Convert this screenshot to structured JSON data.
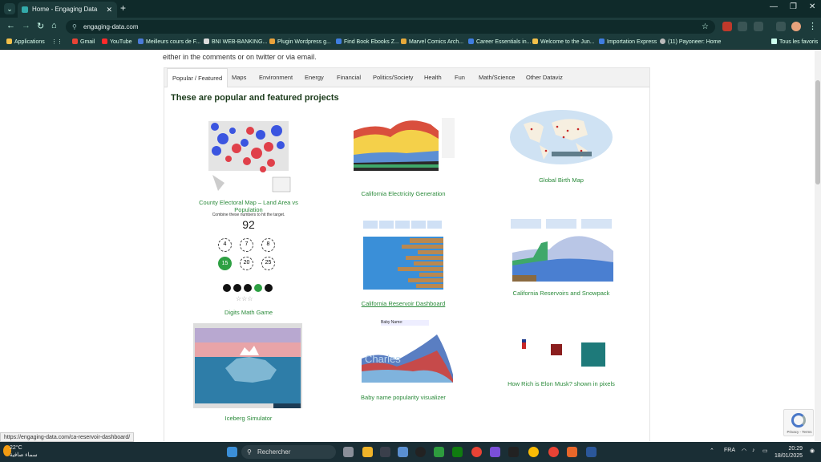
{
  "browser": {
    "tab_title": "Home - Engaging Data",
    "new_tab": "+",
    "url": "engaging-data.com",
    "bookmarks": [
      {
        "label": "Applications",
        "color": "#f3c04a"
      },
      {
        "label": "Gmail",
        "color": "#e94335"
      },
      {
        "label": "YouTube",
        "color": "#ff2a2a"
      },
      {
        "label": "Meilleurs cours de F...",
        "color": "#4b7bd8"
      },
      {
        "label": "BNI WEB-BANKING...",
        "color": "#dddddd"
      },
      {
        "label": "Plugin Wordpress g...",
        "color": "#e9a23b"
      },
      {
        "label": "Find Book Ebooks Z...",
        "color": "#3f7de0"
      },
      {
        "label": "Marvel Comics Arch...",
        "color": "#e6a93a"
      },
      {
        "label": "Career Essentials in...",
        "color": "#3f7de0"
      },
      {
        "label": "Welcome to the Jun...",
        "color": "#f3c04a"
      },
      {
        "label": "Importation Express",
        "color": "#3f7de0"
      },
      {
        "label": "(11) Payoneer: Home",
        "color": "#bbbbbb"
      }
    ],
    "all_bookmarks": "Tous les favoris",
    "status_url": "https://engaging-data.com/ca-reservoir-dashboard/"
  },
  "page": {
    "intro": "either in the comments or on twitter or via email.",
    "tabs": [
      "Popular / Featured",
      "Maps",
      "Environment",
      "Energy",
      "Financial",
      "Politics/Society",
      "Health",
      "Fun",
      "Math/Science",
      "Other Dataviz"
    ],
    "heading": "These are popular and featured projects",
    "cards": [
      {
        "title": "County Electoral Map – Land Area vs Population"
      },
      {
        "title": "California Electricity Generation"
      },
      {
        "title": "Global Birth Map"
      },
      {
        "title": "Digits Math Game"
      },
      {
        "title": "California Reservoir Dashboard"
      },
      {
        "title": "California Reservoirs and Snowpack"
      },
      {
        "title": "Iceberg Simulator"
      },
      {
        "title": "Baby name popularity visualizer"
      },
      {
        "title": "How Rich is Elon Musk? shown in pixels"
      }
    ],
    "digits": {
      "instruction": "Combine these numbers to hit the target.",
      "target": "92",
      "numbers": [
        "4",
        "7",
        "8",
        "15",
        "20",
        "25"
      ]
    },
    "babyname": {
      "label": "Baby Name:",
      "name": "Charles"
    },
    "privacy": "Privacy - Terms"
  },
  "taskbar": {
    "temp": "22°C",
    "weather_desc": "سماء صافية",
    "search": "Rechercher",
    "lang": "FRA",
    "time": "20:29",
    "date": "18/01/2025"
  }
}
